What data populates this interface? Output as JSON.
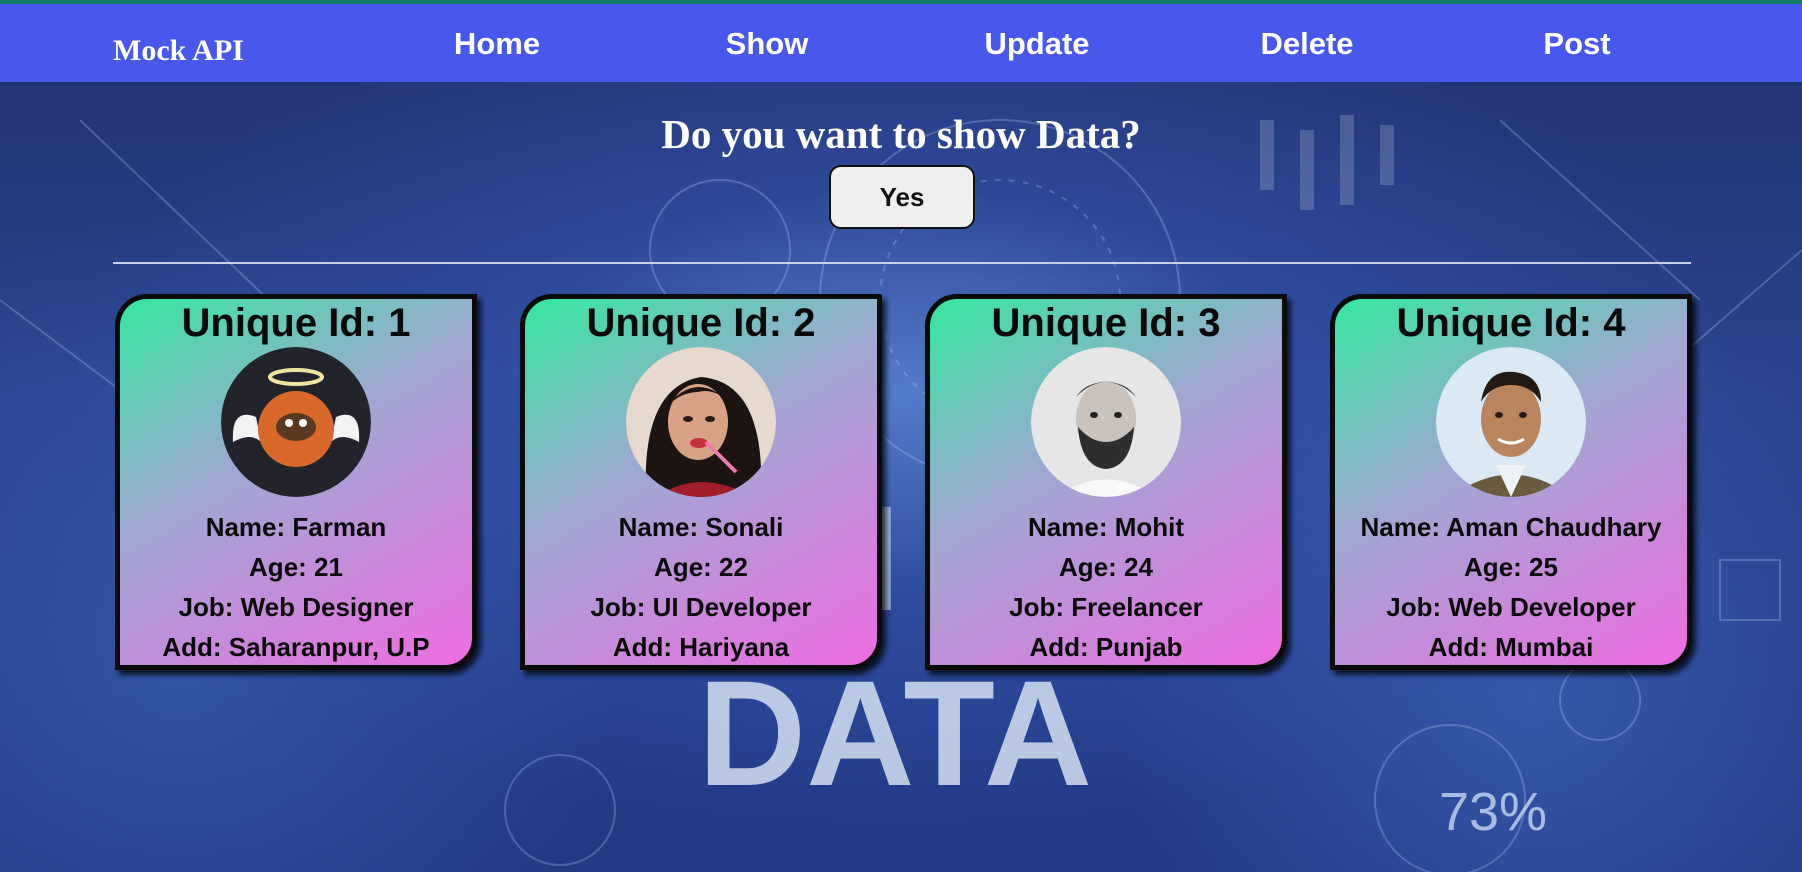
{
  "nav": {
    "brand": "Mock API",
    "links": [
      "Home",
      "Show",
      "Update",
      "Delete",
      "Post"
    ]
  },
  "prompt": {
    "question": "Do you want to show Data?",
    "yes_label": "Yes"
  },
  "background": {
    "caption": "DATA",
    "percent": "73%"
  },
  "cards": [
    {
      "uid": "Unique Id: 1",
      "name": "Name: Farman",
      "age": "Age: 21",
      "job": "Job: Web Designer",
      "add": "Add: Saharanpur, U.P",
      "avatar": "angel-avatar-icon"
    },
    {
      "uid": "Unique Id: 2",
      "name": "Name: Sonali",
      "age": "Age: 22",
      "job": "Job: UI Developer",
      "add": "Add: Hariyana",
      "avatar": "woman-photo"
    },
    {
      "uid": "Unique Id: 3",
      "name": "Name: Mohit",
      "age": "Age: 24",
      "job": "Job: Freelancer",
      "add": "Add: Punjab",
      "avatar": "bearded-man-photo"
    },
    {
      "uid": "Unique Id: 4",
      "name": "Name: Aman Chaudhary",
      "age": "Age: 25",
      "job": "Job: Web Developer",
      "add": "Add: Mumbai",
      "avatar": "man-photo"
    }
  ],
  "colors": {
    "nav": "#4858ec",
    "card_gradient_start": "#35e7a0",
    "card_gradient_end": "#f06ce3"
  }
}
